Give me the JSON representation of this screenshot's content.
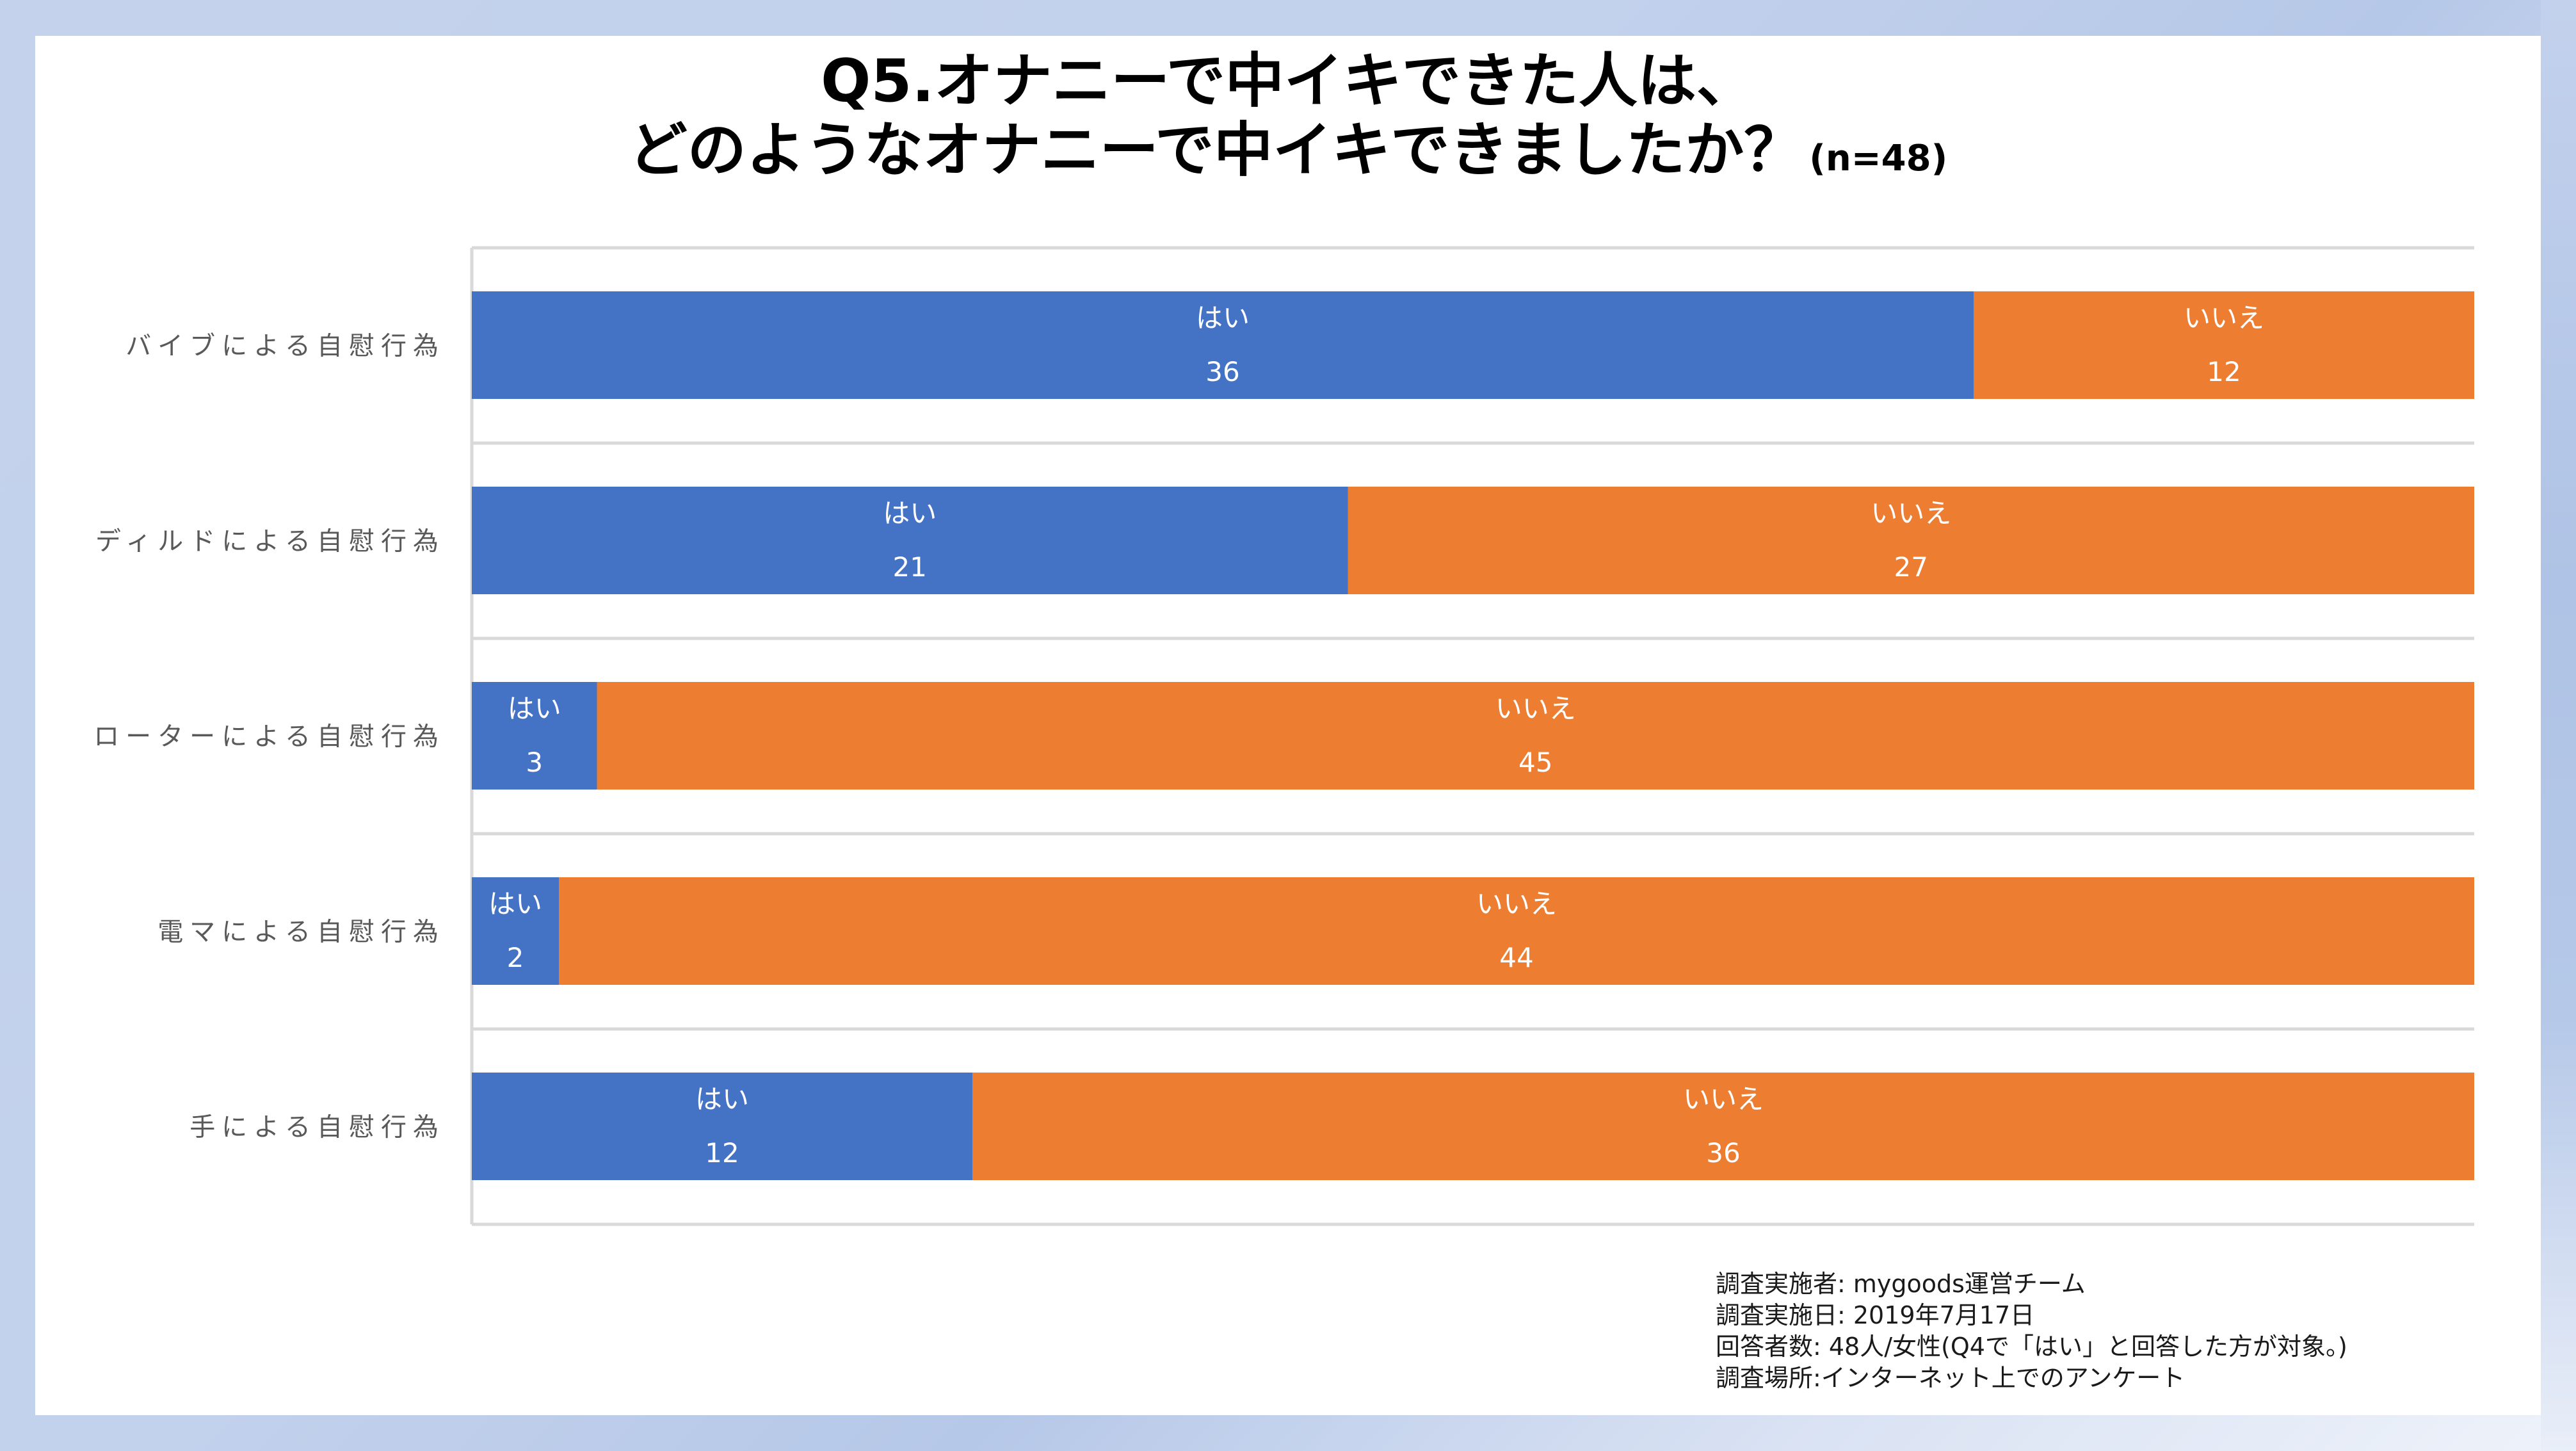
{
  "title": {
    "line1": "Q5.オナニーで中イキできた人は、",
    "line2": "どのようなオナニーで中イキできましたか？",
    "sample_size": "(n=48)"
  },
  "colors": {
    "yes": "#4472C4",
    "no": "#ED7D31",
    "gridline": "#D9D9D9",
    "axis_label": "#595959"
  },
  "chart_data": {
    "type": "bar",
    "orientation": "horizontal",
    "stacking": "percent",
    "title": "Q5.オナニーで中イキできた人は、どのようなオナニーで中イキできましたか？(n=48)",
    "xlabel": "",
    "ylabel": "",
    "categories": [
      "バイブによる自慰行為",
      "ディルドによる自慰行為",
      "ローターによる自慰行為",
      "電マによる自慰行為",
      "手による自慰行為"
    ],
    "series": [
      {
        "name": "はい",
        "values": [
          36,
          21,
          3,
          2,
          12
        ]
      },
      {
        "name": "いいえ",
        "values": [
          12,
          27,
          45,
          44,
          36
        ]
      }
    ],
    "data_labels": "series name and value",
    "legend": "none",
    "grid": true,
    "xlim": [
      0,
      1
    ]
  },
  "footnote": [
    "調査実施者: mygoods運営チーム",
    "調査実施日: 2019年7月17日",
    "回答者数: 48人/女性(Q4で「はい」と回答した方が対象。)",
    "調査場所:インターネット上でのアンケート"
  ]
}
